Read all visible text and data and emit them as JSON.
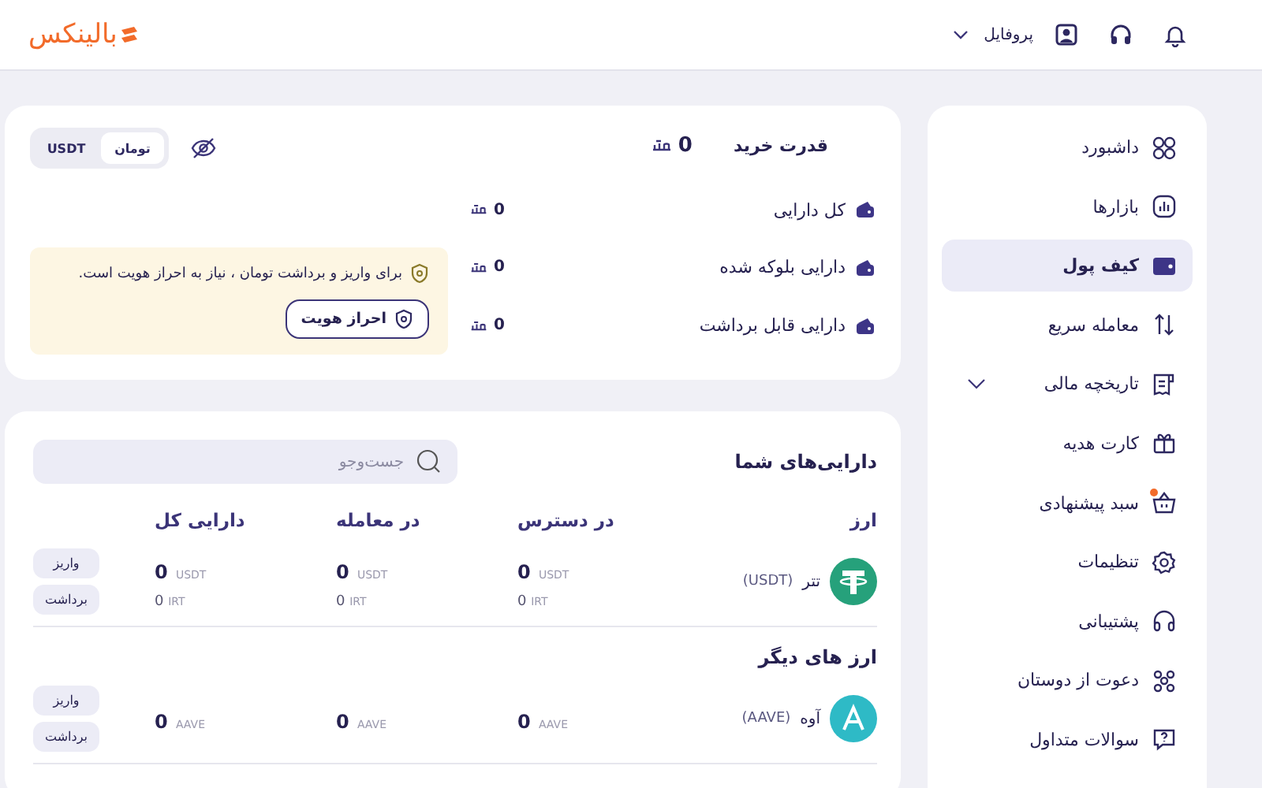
{
  "header": {
    "logo": "بالینکس",
    "profile": "پروفایل"
  },
  "sidebar": {
    "items": [
      {
        "label": "داشبورد",
        "kind": "grid",
        "selected": false,
        "submenu": false,
        "notification": false
      },
      {
        "label": "بازارها",
        "kind": "chart",
        "selected": false,
        "submenu": false,
        "notification": false
      },
      {
        "label": "کیف پول",
        "kind": "wallet",
        "selected": true,
        "submenu": false,
        "notification": false
      },
      {
        "label": "معامله سریع",
        "kind": "swap",
        "selected": false,
        "submenu": false,
        "notification": false
      },
      {
        "label": "تاریخچه مالی",
        "kind": "receipt",
        "selected": false,
        "submenu": true,
        "notification": false
      },
      {
        "label": "کارت هدیه",
        "kind": "gift",
        "selected": false,
        "submenu": false,
        "notification": false
      },
      {
        "label": "سبد پیشنهادی",
        "kind": "basket",
        "selected": false,
        "submenu": false,
        "notification": true
      },
      {
        "label": "تنظیمات",
        "kind": "gear",
        "selected": false,
        "submenu": false,
        "notification": false
      },
      {
        "label": "پشتیبانی",
        "kind": "headset",
        "selected": false,
        "submenu": false,
        "notification": false
      },
      {
        "label": "دعوت از دوستان",
        "kind": "people",
        "selected": false,
        "submenu": false,
        "notification": false
      },
      {
        "label": "سوالات متداول",
        "kind": "faq",
        "selected": false,
        "submenu": false,
        "notification": false
      }
    ]
  },
  "balance": {
    "purchase_power": {
      "label": "قدرت خرید",
      "value": "0"
    },
    "currency_toggle": [
      {
        "label": "تومان",
        "selected": true
      },
      {
        "label": "USDT",
        "selected": false
      }
    ],
    "items": [
      {
        "label": "کل دارایی",
        "value": "0"
      },
      {
        "label": "دارایی بلوکه شده",
        "value": "0"
      },
      {
        "label": "دارایی قابل برداشت",
        "value": "0"
      }
    ],
    "notice": {
      "text": "برای واریز و برداشت تومان ، نیاز به احراز هویت است.",
      "button": "احراز هویت"
    }
  },
  "assets": {
    "title": "دارایی‌های شما",
    "search": {
      "placeholder": "جست‌وجو"
    },
    "columns": [
      "ارز",
      "در دسترس",
      "در معامله",
      "دارایی کل"
    ],
    "rows": [
      {
        "kind": "tether",
        "color": "#26a17b",
        "cells": [
          {
            "name": "تتر",
            "symbol": "(USDT)"
          },
          {
            "amount": "0",
            "unit": "USDT",
            "fiat_amount": "0",
            "fiat_unit": "IRT"
          },
          {
            "amount": "0",
            "unit": "USDT",
            "fiat_amount": "0",
            "fiat_unit": "IRT"
          },
          {
            "amount": "0",
            "unit": "USDT",
            "fiat_amount": "0",
            "fiat_unit": "IRT"
          }
        ],
        "actions": [
          "واریز",
          "برداشت"
        ]
      }
    ],
    "other": {
      "title": "ارز های دیگر",
      "rows": [
        {
          "kind": "aave",
          "color": "#2ebac6",
          "cells": [
            {
              "name": "آوه",
              "symbol": "(AAVE)"
            },
            {
              "amount": "0",
              "unit": "AAVE"
            },
            {
              "amount": "0",
              "unit": "AAVE"
            },
            {
              "amount": "0",
              "unit": "AAVE"
            }
          ],
          "actions": [
            "واریز",
            "برداشت"
          ]
        }
      ]
    }
  }
}
